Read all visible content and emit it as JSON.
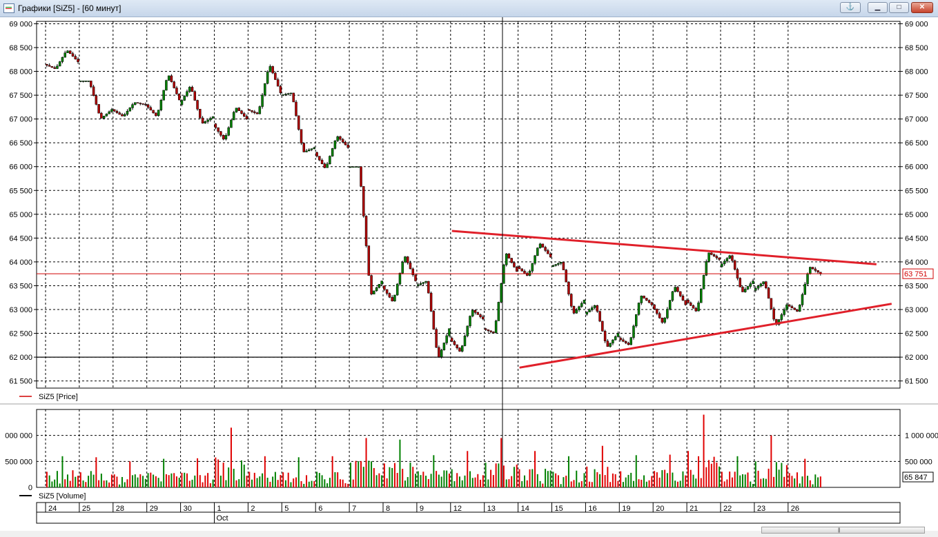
{
  "window": {
    "title": "Графики [SiZ5] - [60 минут]",
    "controls": [
      "anchor",
      "minimize",
      "maximize",
      "close"
    ]
  },
  "legend": {
    "price": "SiZ5 [Price]",
    "volume": "SiZ5 [Volume]"
  },
  "price_axis": {
    "ticks": [
      61500,
      62000,
      62500,
      63000,
      63500,
      64000,
      64500,
      65000,
      65500,
      66000,
      66500,
      67000,
      67500,
      68000,
      68500,
      69000
    ],
    "labels": [
      "61 500",
      "62 000",
      "62 500",
      "63 000",
      "63 500",
      "64 000",
      "64 500",
      "65 000",
      "65 500",
      "66 000",
      "66 500",
      "67 000",
      "67 500",
      "68 000",
      "68 500",
      "69 000"
    ],
    "current_value": 63751,
    "current_label": "63 751",
    "horizontal_level": 62000
  },
  "volume_axis": {
    "ticks": [
      0,
      500000,
      1000000
    ],
    "left_labels": [
      "0",
      "500 000",
      "000 000"
    ],
    "right_labels": [
      "500 000",
      "1 000 000"
    ],
    "current_label": "65 847"
  },
  "time_axis": {
    "days": [
      "24",
      "25",
      "28",
      "29",
      "30",
      "1",
      "2",
      "5",
      "6",
      "7",
      "8",
      "9",
      "12",
      "13",
      "14",
      "15",
      "16",
      "19",
      "20",
      "21",
      "22",
      "23",
      "26"
    ],
    "month_label": "Oct",
    "month_label_day": "1"
  },
  "chart_data": {
    "type": "candlestick",
    "instrument": "SiZ5",
    "timeframe": "60 минут",
    "ylim": [
      61350,
      69050
    ],
    "daily_ohlc": [
      {
        "day": "24",
        "open": 68150,
        "high": 68450,
        "low": 68050,
        "close": 68200
      },
      {
        "day": "25",
        "open": 67800,
        "high": 67800,
        "low": 67000,
        "close": 67200
      },
      {
        "day": "28",
        "open": 67200,
        "high": 67350,
        "low": 67050,
        "close": 67300
      },
      {
        "day": "29",
        "open": 67300,
        "high": 67950,
        "low": 67050,
        "close": 67400
      },
      {
        "day": "30",
        "open": 67300,
        "high": 67700,
        "low": 66900,
        "close": 67050
      },
      {
        "day": "1",
        "open": 66900,
        "high": 67250,
        "low": 66550,
        "close": 67000
      },
      {
        "day": "2",
        "open": 67200,
        "high": 68150,
        "low": 67100,
        "close": 67550
      },
      {
        "day": "5",
        "open": 67500,
        "high": 67550,
        "low": 66300,
        "close": 66400
      },
      {
        "day": "6",
        "open": 66300,
        "high": 66650,
        "low": 65950,
        "close": 66400
      },
      {
        "day": "7",
        "open": 66000,
        "high": 66000,
        "low": 63300,
        "close": 63600
      },
      {
        "day": "8",
        "open": 63500,
        "high": 64150,
        "low": 63150,
        "close": 63600
      },
      {
        "day": "9",
        "open": 63500,
        "high": 63600,
        "low": 61950,
        "close": 62600
      },
      {
        "day": "12",
        "open": 62400,
        "high": 63000,
        "low": 62100,
        "close": 62800
      },
      {
        "day": "13",
        "open": 62600,
        "high": 64200,
        "low": 62500,
        "close": 63800
      },
      {
        "day": "14",
        "open": 63900,
        "high": 64400,
        "low": 63700,
        "close": 64100
      },
      {
        "day": "15",
        "open": 63900,
        "high": 64000,
        "low": 62900,
        "close": 63200
      },
      {
        "day": "16",
        "open": 62900,
        "high": 63100,
        "low": 62200,
        "close": 62500
      },
      {
        "day": "19",
        "open": 62400,
        "high": 63300,
        "low": 62250,
        "close": 63100
      },
      {
        "day": "20",
        "open": 63100,
        "high": 63500,
        "low": 62700,
        "close": 63100
      },
      {
        "day": "21",
        "open": 63200,
        "high": 64200,
        "low": 62950,
        "close": 64050
      },
      {
        "day": "22",
        "open": 63900,
        "high": 64150,
        "low": 63350,
        "close": 63600
      },
      {
        "day": "23",
        "open": 63400,
        "high": 63600,
        "low": 62650,
        "close": 63100
      },
      {
        "day": "26",
        "open": 63100,
        "high": 63900,
        "low": 62950,
        "close": 63750
      }
    ],
    "trendlines": [
      {
        "name": "resistance",
        "from": {
          "x": "12",
          "y": 64650
        },
        "to": {
          "x": "26",
          "y": 63950
        }
      },
      {
        "name": "support",
        "from": {
          "x": "14",
          "y": 61780
        },
        "to": {
          "x": "26",
          "y": 63120
        }
      }
    ],
    "volume": {
      "ylim": [
        0,
        1500000
      ],
      "daily_max": [
        600000,
        580000,
        500000,
        550000,
        560000,
        1150000,
        600000,
        580000,
        600000,
        950000,
        920000,
        620000,
        700000,
        950000,
        700000,
        600000,
        800000,
        620000,
        630000,
        1400000,
        600000,
        1000000,
        550000
      ]
    }
  },
  "colors": {
    "up_candle": "#008000",
    "down_candle": "#b00000",
    "trendline": "#e0202a",
    "current_price_line": "#d00000",
    "grid": "#000000",
    "up_volume": "#008000",
    "down_volume": "#e00000"
  }
}
